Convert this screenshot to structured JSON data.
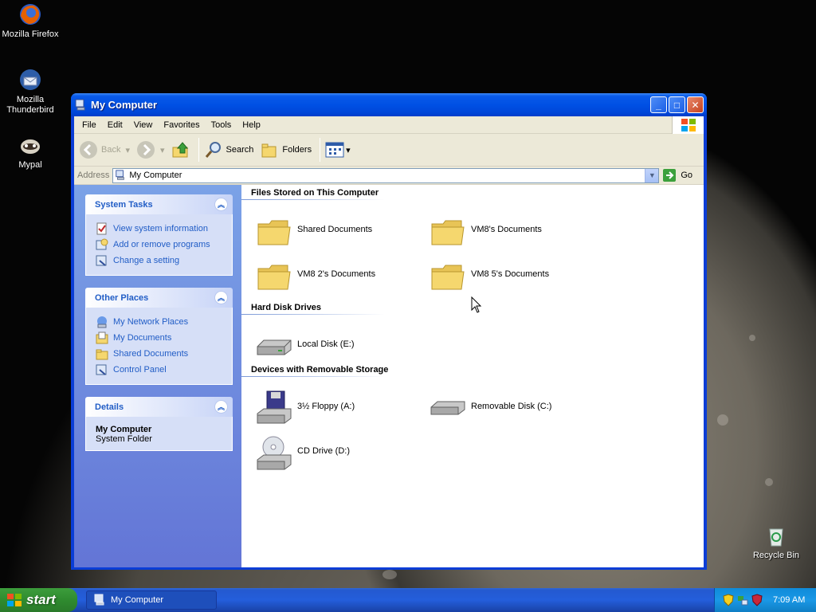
{
  "desktop": {
    "icons": [
      {
        "label": "Mozilla Firefox"
      },
      {
        "label": "Mozilla Thunderbird"
      },
      {
        "label": "Mypal"
      },
      {
        "label": "Recycle Bin"
      }
    ]
  },
  "window": {
    "title": "My Computer",
    "menu": [
      "File",
      "Edit",
      "View",
      "Favorites",
      "Tools",
      "Help"
    ],
    "toolbar": {
      "back": "Back",
      "search": "Search",
      "folders": "Folders"
    },
    "address": {
      "label": "Address",
      "value": "My Computer",
      "go": "Go"
    },
    "taskpane": {
      "system_tasks": {
        "title": "System Tasks",
        "items": [
          "View system information",
          "Add or remove programs",
          "Change a setting"
        ]
      },
      "other_places": {
        "title": "Other Places",
        "items": [
          "My Network Places",
          "My Documents",
          "Shared Documents",
          "Control Panel"
        ]
      },
      "details": {
        "title": "Details",
        "name": "My Computer",
        "type": "System Folder"
      }
    },
    "groups": {
      "files": {
        "title": "Files Stored on This Computer",
        "items": [
          "Shared Documents",
          "VM8's Documents",
          "VM8 2's Documents",
          "VM8 5's Documents"
        ]
      },
      "hard_disks": {
        "title": "Hard Disk Drives",
        "items": [
          "Local Disk (E:)"
        ]
      },
      "removable": {
        "title": "Devices with Removable Storage",
        "items": [
          "3½ Floppy (A:)",
          "Removable Disk (C:)",
          "CD Drive (D:)"
        ]
      }
    }
  },
  "taskbar": {
    "start": "start",
    "task": "My Computer",
    "clock": "7:09 AM"
  },
  "colors": {
    "title_blue": "#0050e4",
    "taskpane_link": "#215dc6",
    "start_green": "#3c9d3c"
  }
}
